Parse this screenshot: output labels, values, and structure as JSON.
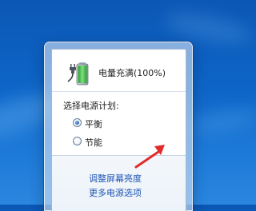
{
  "battery": {
    "status": "电量充满(100%)",
    "icon": "battery-full-plugged-icon",
    "level_percent": 100,
    "color": "#34b43a"
  },
  "power_plan": {
    "label": "选择电源计划:",
    "options": [
      {
        "label": "平衡",
        "selected": true
      },
      {
        "label": "节能",
        "selected": false
      }
    ]
  },
  "links": {
    "adjust_brightness": "调整屏幕亮度",
    "more_power_options": "更多电源选项"
  },
  "annotation": {
    "icon": "red-arrow-icon",
    "color": "#e12a2a"
  },
  "theme": {
    "link_color": "#1f56b3",
    "desktop_color": "#0e66c8"
  }
}
